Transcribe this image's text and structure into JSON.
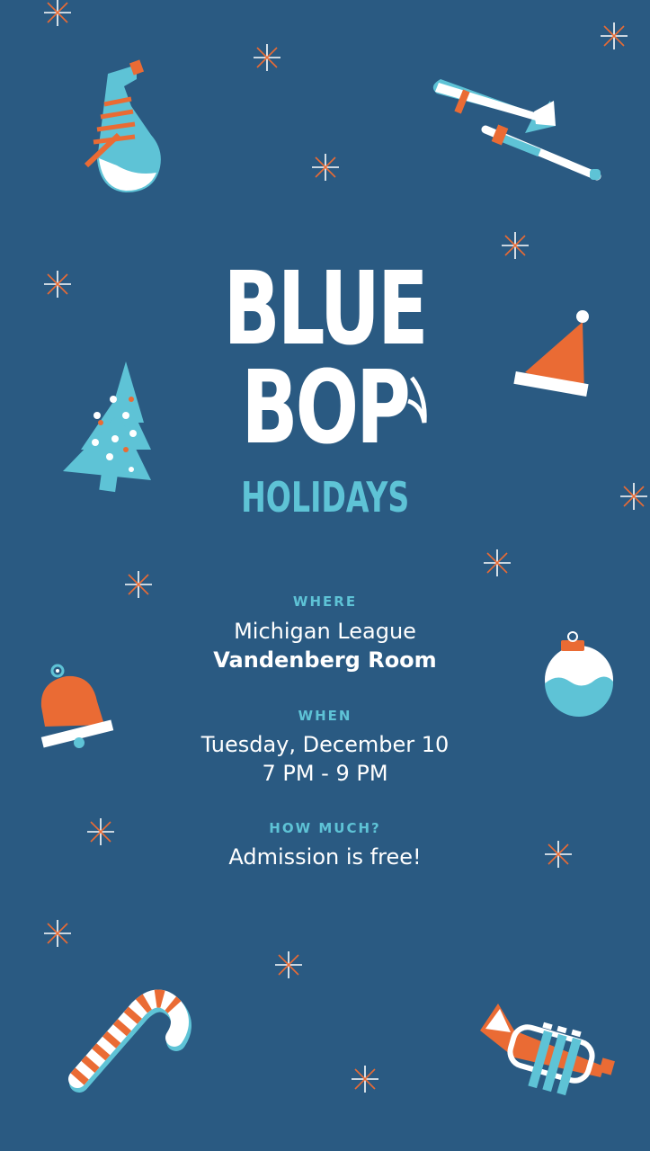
{
  "colors": {
    "background": "#2a5a82",
    "orange": "#ea6b34",
    "teal": "#5ec3d6",
    "white": "#ffffff"
  },
  "logo": {
    "line1": "BLUE",
    "line2": "BOP",
    "line3": "HOLIDAYS"
  },
  "where": {
    "label": "WHERE",
    "venue": "Michigan League",
    "room": "Vandenberg Room"
  },
  "when": {
    "label": "WHEN",
    "date": "Tuesday, December 10",
    "time": "7 PM - 9 PM"
  },
  "how_much": {
    "label": "HOW MUCH?",
    "price": "Admission is free!"
  },
  "icons": [
    "saxophone-icon",
    "trombone-icon",
    "santa-hat-icon",
    "christmas-tree-icon",
    "ornament-icon",
    "bell-icon",
    "candy-cane-icon",
    "trumpet-icon",
    "sparkle-icon"
  ]
}
